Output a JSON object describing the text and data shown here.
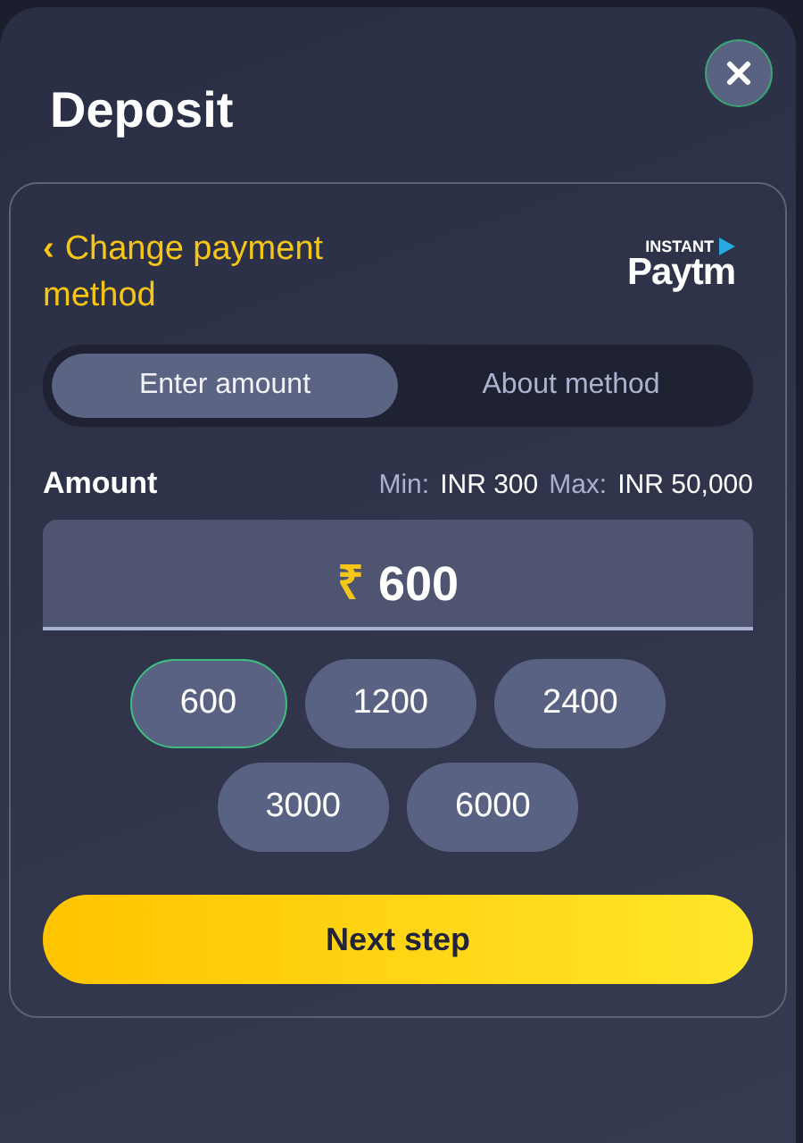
{
  "title": "Deposit",
  "back_link": {
    "icon": "‹",
    "label": "Change payment method"
  },
  "logo": {
    "top": "INSTANT",
    "bottom": "Paytm"
  },
  "tabs": [
    {
      "label": "Enter amount",
      "selected": true
    },
    {
      "label": "About method",
      "selected": false
    }
  ],
  "amount": {
    "label": "Amount",
    "limits": [
      {
        "label": "Min:",
        "value": "INR 300"
      },
      {
        "label": "Max:",
        "value": "INR 50,000"
      }
    ],
    "currency": "₹",
    "value": "600"
  },
  "presets": [
    {
      "label": "600",
      "selected": true
    },
    {
      "label": "1200",
      "selected": false
    },
    {
      "label": "2400",
      "selected": false
    },
    {
      "label": "3000",
      "selected": false
    },
    {
      "label": "6000",
      "selected": false
    }
  ],
  "submit": "Next step"
}
